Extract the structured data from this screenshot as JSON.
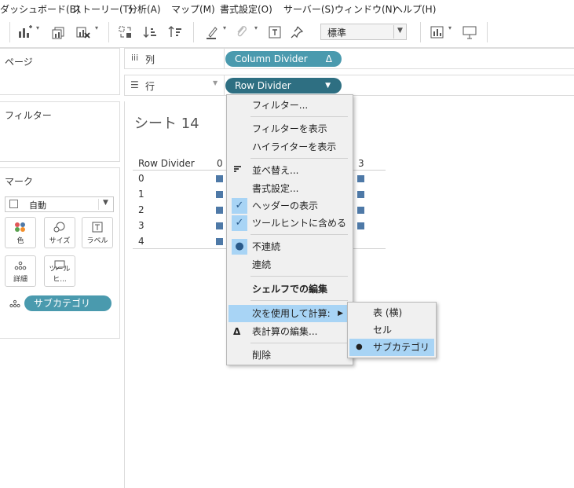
{
  "menubar": {
    "items": [
      "ダッシュボード(B)",
      "ストーリー(T)",
      "分析(A)",
      "マップ(M)",
      "書式設定(O)",
      "サーバー(S)",
      "ウィンドウ(N)",
      "ヘルプ(H)"
    ]
  },
  "toolbar": {
    "format_select": "標準"
  },
  "panes": {
    "pages": "ページ",
    "filters": "フィルター",
    "marks": "マーク",
    "mark_type": "自動",
    "mark_buttons": [
      "色",
      "サイズ",
      "ラベル",
      "詳細",
      "ツールヒ..."
    ],
    "mark_pill": "サブカテゴリ"
  },
  "shelves": {
    "columns_label": "列",
    "rows_label": "行",
    "column_pill": "Column Divider",
    "column_pill_icon": "Δ",
    "row_pill": "Row Divider"
  },
  "sheet": {
    "title": "シート 14",
    "header_row_label": "Row Divider",
    "column_headers": [
      "0",
      "3"
    ],
    "rows": [
      "0",
      "1",
      "2",
      "3",
      "4"
    ]
  },
  "context_menu": {
    "items": [
      "フィルター...",
      "フィルターを表示",
      "ハイライターを表示",
      "並べ替え...",
      "書式設定...",
      "ヘッダーの表示",
      "ツールヒントに含める",
      "不連続",
      "連続",
      "シェルフでの編集",
      "次を使用して計算:",
      "表計算の編集...",
      "削除"
    ]
  },
  "submenu": {
    "items": [
      "表 (横)",
      "セル",
      "サブカテゴリ"
    ]
  },
  "colors": {
    "pill": "#4a9aae",
    "pill_dark": "#2e6f82",
    "mark": "#4e79a7",
    "highlight": "#a8d4f5"
  }
}
